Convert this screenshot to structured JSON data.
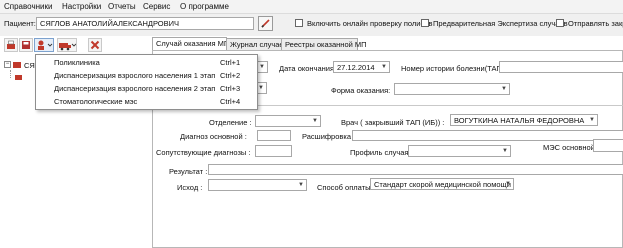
{
  "menubar": [
    "Справочники",
    "Настройки",
    "Отчеты",
    "Сервис",
    "О программе"
  ],
  "patient": {
    "label": "Пациент:",
    "value": "СЯГЛОВ АНАТОЛИЙАЛЕКСАНДРОВИЧ"
  },
  "options": {
    "online_check": "Включить онлайн проверку полисов",
    "pre_expertise": "Предварительная Экспертиза случаев",
    "send_closed": "Отправлять закры"
  },
  "tabs": [
    "Случай оказания МП",
    "Журнал случаев",
    "Реестры оказанной МП"
  ],
  "tree": {
    "root_label": "СЯГ"
  },
  "dropdown_menu": [
    {
      "label": "Поликлиника",
      "shortcut": "Ctrl+1"
    },
    {
      "label": "Диспансеризация взрослого населения 1 этап",
      "shortcut": "Ctrl+2"
    },
    {
      "label": "Диспансеризация взрослого населения 2 этап",
      "shortcut": "Ctrl+3"
    },
    {
      "label": "Стоматологические мэс",
      "shortcut": "Ctrl+4"
    }
  ],
  "form": {
    "end_date_label": "Дата окончания:",
    "end_date_value": "27.12.2014",
    "history_label": "Номер истории болезни(ТАП) :",
    "history_value": "",
    "form_label": "Форма оказания:",
    "form_value": "",
    "department_label": "Отделение :",
    "department_value": "",
    "doctor_label": "Врач ( закрывший ТАП (ИБ)) :",
    "doctor_value": "ВОГУТКИНА НАТАЛЬЯ ФЕДОРОВНА",
    "diagnosis_label": "Диагноз основной :",
    "decoding_label": "Расшифровка :",
    "concomitant_label": "Сопутствующие диагнозы :",
    "profile_label": "Профиль случая:",
    "mes_label": "МЭС основной:",
    "result_label": "Результат :",
    "outcome_label": "Исход :",
    "payment_label": "Способ оплаты:",
    "payment_value": "Стандарт скорой медицинской помощи"
  }
}
